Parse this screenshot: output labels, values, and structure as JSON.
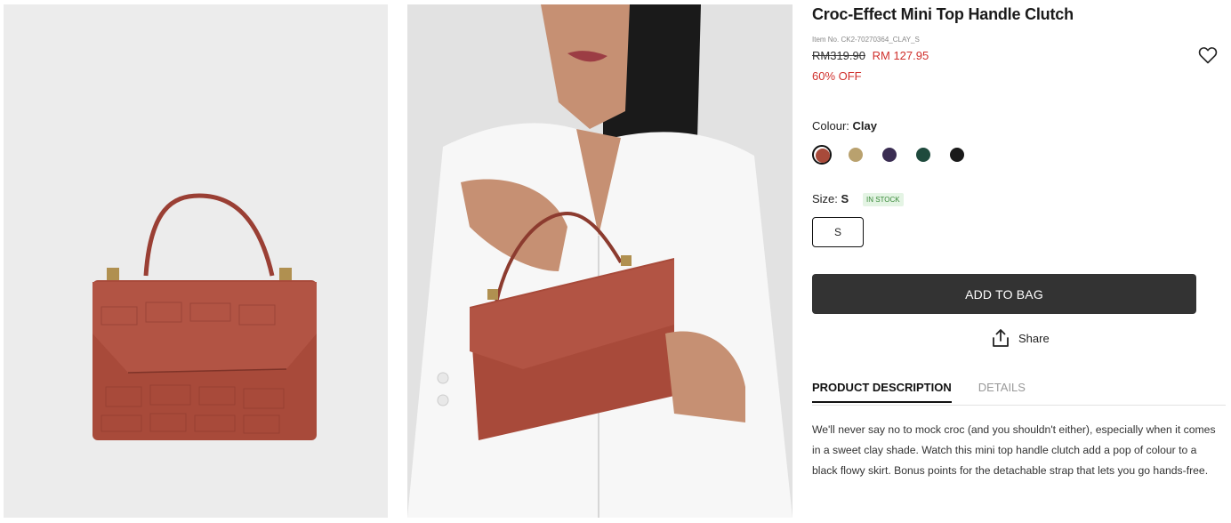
{
  "product": {
    "title": "Croc-Effect Mini Top Handle Clutch",
    "item_no": "Item No. CK2-70270364_CLAY_S",
    "original_price": "RM319.90",
    "sale_price": "RM 127.95",
    "discount": "60% OFF"
  },
  "colour": {
    "label": "Colour:",
    "selected": "Clay",
    "swatches": [
      {
        "name": "Clay",
        "hex": "#a84a3a"
      },
      {
        "name": "Khaki",
        "hex": "#b9a16e"
      },
      {
        "name": "Purple",
        "hex": "#3a2d52"
      },
      {
        "name": "Green",
        "hex": "#1f4a3d"
      },
      {
        "name": "Black",
        "hex": "#1a1a1a"
      }
    ]
  },
  "size": {
    "label": "Size:",
    "selected": "S",
    "stock": "IN STOCK",
    "options": [
      "S"
    ]
  },
  "actions": {
    "add_to_bag": "ADD TO BAG",
    "share": "Share"
  },
  "tabs": [
    {
      "label": "PRODUCT DESCRIPTION",
      "active": true
    },
    {
      "label": "DETAILS",
      "active": false
    }
  ],
  "description": "We'll never say no to mock croc (and you shouldn't either), especially when it comes in a sweet clay shade. Watch this mini top handle clutch add a pop of colour to a black flowy skirt. Bonus points for the detachable strap that lets you go hands-free.",
  "icons": {
    "wishlist": "heart-icon",
    "share": "share-icon"
  },
  "colors": {
    "sale_red": "#d0312d",
    "button_dark": "#333333",
    "stock_green": "#3a8a3a"
  }
}
